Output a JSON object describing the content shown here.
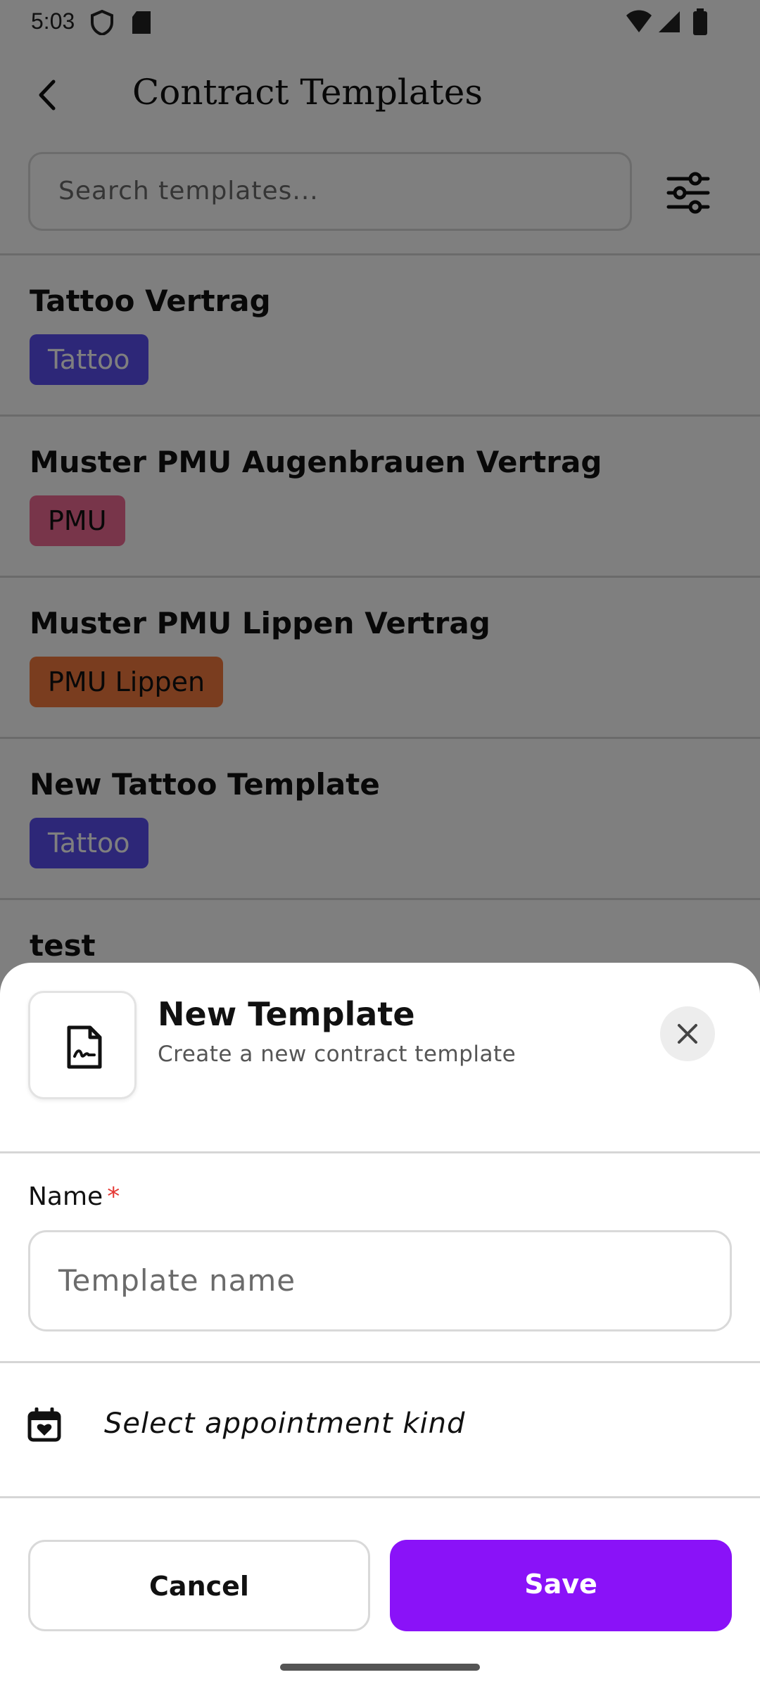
{
  "status_bar": {
    "time": "5:03"
  },
  "header": {
    "title": "Contract Templates"
  },
  "search": {
    "placeholder": "Search templates..."
  },
  "colors": {
    "tattoo": "#5b4ff0",
    "pmu": "#f06a95",
    "pmu_lippen": "#f47b3f",
    "accent": "#8a12f8"
  },
  "templates": [
    {
      "name": "Tattoo Vertrag",
      "tag": "Tattoo"
    },
    {
      "name": "Muster PMU Augenbrauen Vertrag",
      "tag": "PMU"
    },
    {
      "name": "Muster PMU Lippen Vertrag",
      "tag": "PMU Lippen"
    },
    {
      "name": "New Tattoo Template",
      "tag": "Tattoo"
    },
    {
      "name": "test"
    }
  ],
  "sheet": {
    "title": "New Template",
    "subtitle": "Create a new contract template",
    "name_label": "Name",
    "required_mark": "*",
    "name_placeholder": "Template name",
    "appointment_kind": "Select appointment kind",
    "cancel": "Cancel",
    "save": "Save"
  }
}
